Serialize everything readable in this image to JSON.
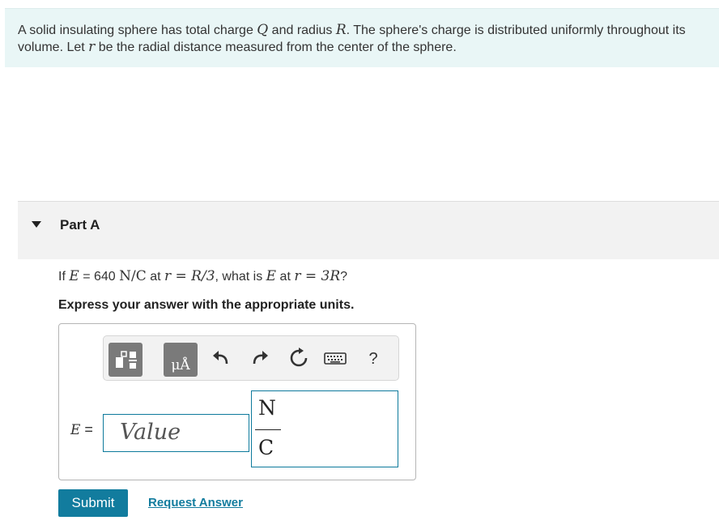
{
  "intro": {
    "t1": "A solid insulating sphere has total charge ",
    "Q": "Q",
    "t2": " and radius ",
    "R": "R",
    "t3": ". The sphere's charge is distributed uniformly throughout its volume. Let ",
    "r": "r",
    "t4": " be the radial distance measured from the center of the sphere."
  },
  "part": {
    "title": "Part A"
  },
  "question": {
    "if": "If ",
    "E": "E",
    "eq_value": " = 640 ",
    "unit": "N/C",
    "at": " at ",
    "cond1": "r = R/3",
    "what": ", what is ",
    "E2": "E",
    "at2": " at ",
    "cond2": "r = 3R",
    "qmark": "?"
  },
  "instruction": "Express your answer with the appropriate units.",
  "toolbar": {
    "tools": [
      {
        "name": "templates-icon"
      },
      {
        "name": "units-icon",
        "label": "μÅ"
      },
      {
        "name": "undo-icon"
      },
      {
        "name": "redo-icon"
      },
      {
        "name": "reset-icon"
      },
      {
        "name": "keyboard-icon"
      },
      {
        "name": "help-icon",
        "label": "?"
      }
    ]
  },
  "answer": {
    "label_var": "E",
    "label_eq": " =",
    "value_placeholder": "Value",
    "unit_numerator": "N",
    "unit_denominator": "C"
  },
  "buttons": {
    "submit": "Submit",
    "request": "Request Answer"
  },
  "colors": {
    "accent": "#127c9e",
    "intro_bg": "#e9f6f6",
    "part_bg": "#f2f2f2"
  }
}
